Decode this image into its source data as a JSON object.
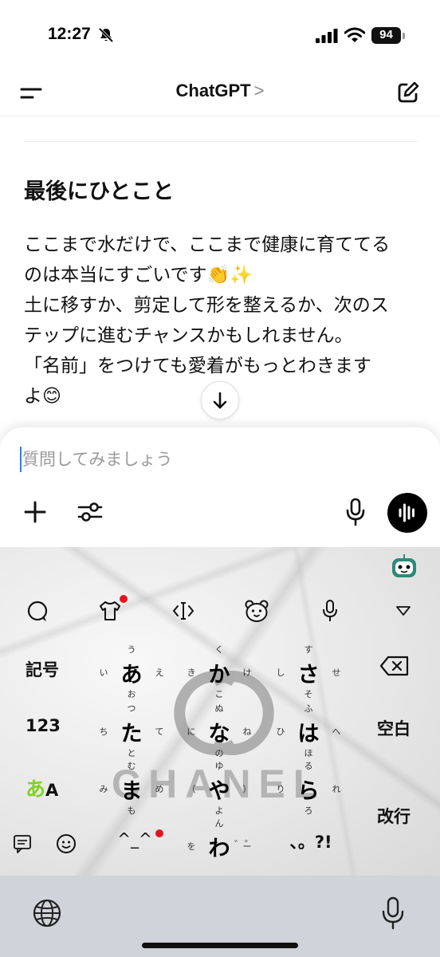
{
  "status_bar": {
    "time": "12:27",
    "battery": "94"
  },
  "header": {
    "title": "ChatGPT",
    "chevron": ">"
  },
  "message": {
    "heading": "最後にひとこと",
    "lines": [
      "ここまで水だけで、ここまで健康に育ててる",
      "のは本当にすごいです👏✨",
      "土に移すか、剪定して形を整えるか、次のス",
      "テップに進むチャンスかもしれません。",
      "「名前」をつけても愛着がもっとわきます",
      "よ😊"
    ]
  },
  "composer": {
    "placeholder": "質問してみましょう",
    "value": ""
  },
  "keyboard": {
    "toolbar_icons": [
      "chat-bubble-icon",
      "t-shirt-icon",
      "cursor-move-icon",
      "bear-face-icon",
      "mic-icon",
      "collapse-triangle-icon"
    ],
    "left_keys": {
      "symbols": "記号",
      "numbers": "123",
      "kana_mode": "あ",
      "alpha_mode": "A"
    },
    "right_keys": {
      "space": "空白",
      "enter": "改行"
    },
    "kana_keys": [
      {
        "main": "あ",
        "up": "う",
        "left": "い",
        "right": "え",
        "down": "お"
      },
      {
        "main": "か",
        "up": "く",
        "left": "き",
        "right": "け",
        "down": "こ"
      },
      {
        "main": "さ",
        "up": "す",
        "left": "し",
        "right": "せ",
        "down": "そ"
      },
      {
        "main": "た",
        "up": "つ",
        "left": "ち",
        "right": "て",
        "down": "と"
      },
      {
        "main": "な",
        "up": "ぬ",
        "left": "に",
        "right": "ね",
        "down": "の"
      },
      {
        "main": "は",
        "up": "ふ",
        "left": "ひ",
        "right": "へ",
        "down": "ほ"
      },
      {
        "main": "ま",
        "up": "む",
        "left": "み",
        "right": "め",
        "down": "も"
      },
      {
        "main": "や",
        "up": "ゆ",
        "left": "（",
        "right": "）",
        "down": "よ"
      },
      {
        "main": "ら",
        "up": "る",
        "left": "り",
        "right": "れ",
        "down": "ろ"
      },
      {
        "main": "わ",
        "up": "ん",
        "left": "を",
        "right": "ー",
        "down": ""
      }
    ],
    "bottom_row": {
      "kaomoji": "^_^",
      "small_kana": "゛゜",
      "punctuation": "、。?!"
    },
    "watermark": "CHANEL"
  },
  "colors": {
    "accent_caret": "#2f7cf6",
    "notification_dot": "#e4141e",
    "kana_mode_green": "#7ed321"
  }
}
